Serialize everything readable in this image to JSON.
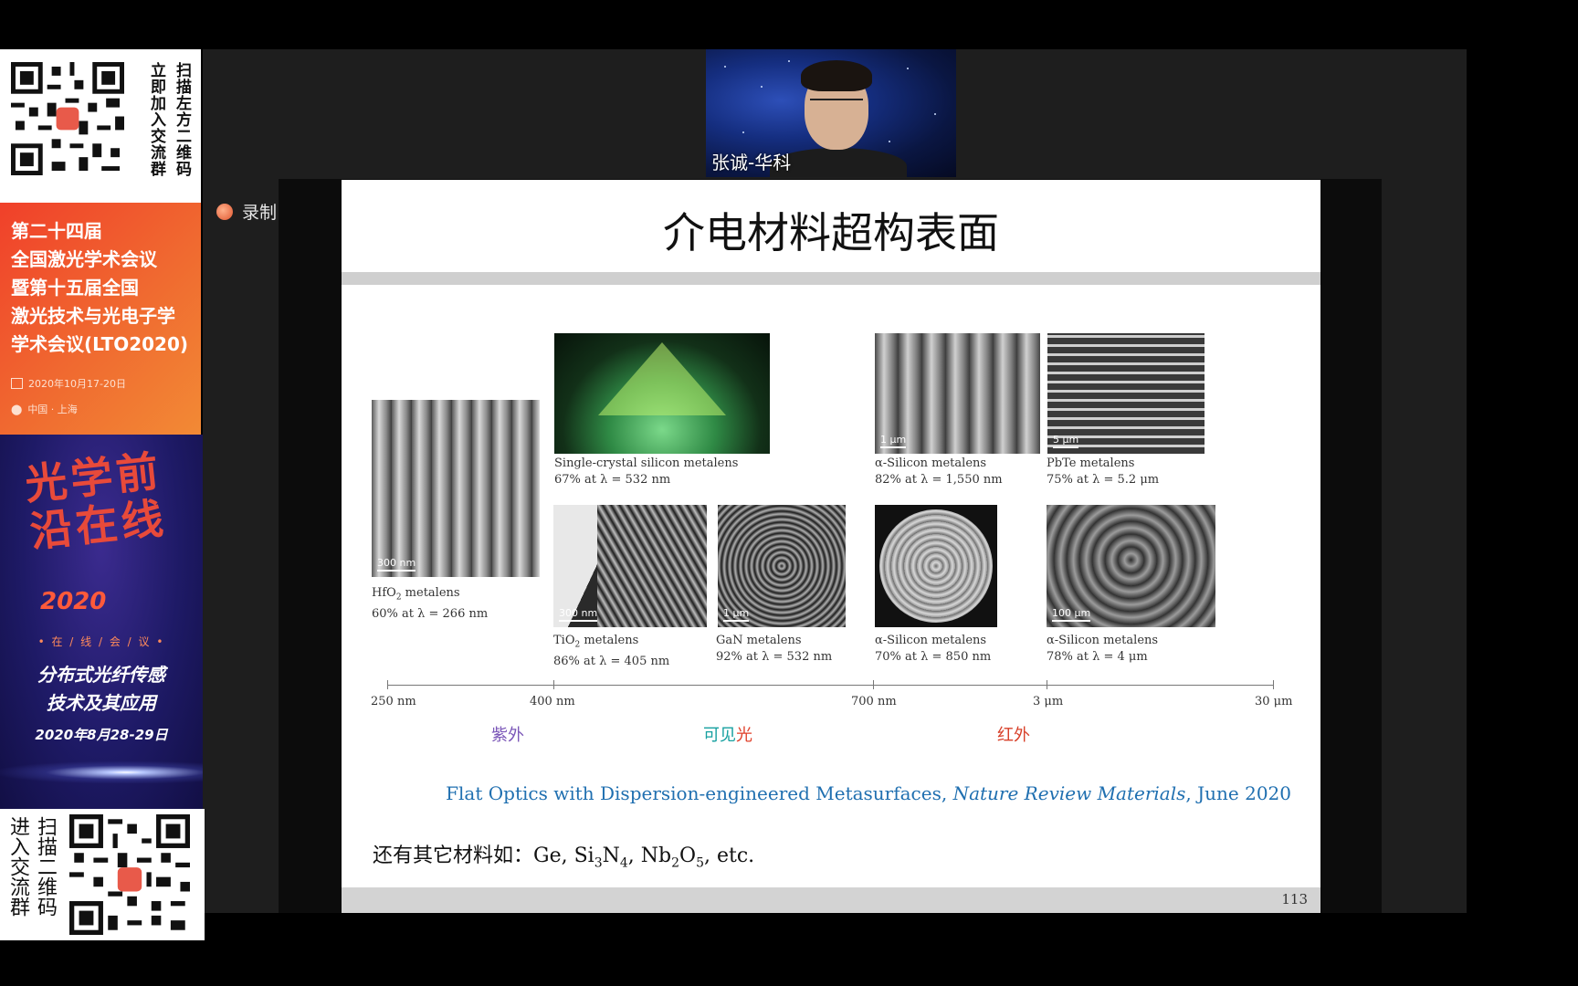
{
  "colors": {
    "conference_red": "#f0402a",
    "promo_purple": "#1e1a66",
    "reference_blue": "#1f6fb0",
    "uv_purple": "#7b57b8",
    "visible_teal": "#16a0a0",
    "visible_red": "#e0402a",
    "ir_red": "#d8402a"
  },
  "video": {
    "speaker_name": "张诚-华科"
  },
  "record": {
    "label": "录制",
    "icon": "record-icon"
  },
  "slide": {
    "title": "介电材料超构表面",
    "page_number": "113",
    "items": [
      {
        "name": "HfO",
        "sub": "2",
        "suffix": " metalens",
        "line2": "60% at λ = 266 nm",
        "scale": "300 nm"
      },
      {
        "name": "Single-crystal silicon metalens",
        "line2": "67% at λ = 532 nm"
      },
      {
        "name": "TiO",
        "sub": "2",
        "suffix": " metalens",
        "line2": "86% at λ = 405 nm",
        "scale": "300 nm"
      },
      {
        "name": "GaN metalens",
        "line2": "92% at λ = 532 nm",
        "scale": "1 μm"
      },
      {
        "name": "α-Silicon metalens",
        "line2": "82% at λ = 1,550 nm",
        "scale": "1 μm"
      },
      {
        "name": "PbTe metalens",
        "line2": "75% at λ = 5.2 μm",
        "scale": "5 μm"
      },
      {
        "name": "α-Silicon metalens",
        "line2": "70% at λ = 850 nm"
      },
      {
        "name": "α-Silicon metalens",
        "line2": "78% at λ = 4 μm",
        "scale": "100 μm"
      }
    ],
    "axis_ticks": [
      "250 nm",
      "400 nm",
      "700 nm",
      "3 μm",
      "30 μm"
    ],
    "bands": {
      "uv": "紫外",
      "visible_a": "可见",
      "visible_b": "光",
      "ir": "红外"
    },
    "reference": {
      "title": "Flat Optics with Dispersion-engineered Metasurfaces,",
      "journal": "Nature Review Materials",
      "date": ", June 2020"
    },
    "other_materials": {
      "prefix": "还有其它材料如：Ge, Si",
      "s1": "3",
      "n": "N",
      "s2": "4",
      "mid": ", Nb",
      "s3": "2",
      "o": "O",
      "s4": "5",
      "suffix": ", etc."
    }
  },
  "banner": {
    "qr_top_text_col1": "扫描左方二维码",
    "qr_top_text_col2": "立即加入交流群",
    "conference_title_lines": [
      "第二十四届",
      "全国激光学术会议",
      "暨第十五届全国",
      "激光技术与光电子学",
      "学术会议(LTO2020)"
    ],
    "conference_date": "2020年10月17-20日",
    "conference_location": "中国 · 上海",
    "promo_calligraphy": "光学前沿在线",
    "promo_year": "2020",
    "promo_online": "• 在 / 线 / 会 / 议 •",
    "promo_topic_lines": [
      "分布式光纤传感",
      "技术及其应用"
    ],
    "promo_date": "2020年8月28-29日",
    "qr_bottom_text_col1": "扫描二维码",
    "qr_bottom_text_col2": "进入交流群"
  }
}
